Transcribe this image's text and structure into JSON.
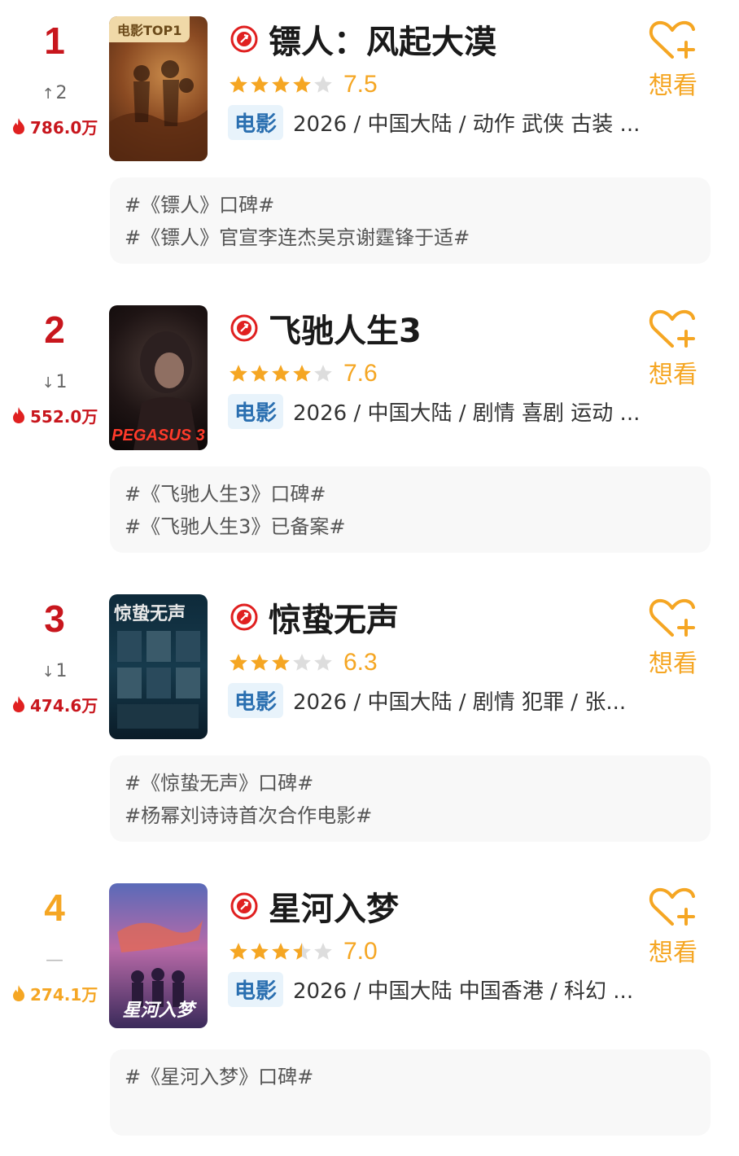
{
  "colors": {
    "rank_red": "#c8161d",
    "rank_orange": "#f5a623",
    "heat_red": "#e02020",
    "heat_orange": "#f5a623",
    "star_gold": "#f5a623",
    "star_grey": "#dddddd",
    "want_gold": "#f5a623",
    "tag_blue": "#2a6fb0"
  },
  "want_label": "想看",
  "type_tag": "电影",
  "items": [
    {
      "rank": "1",
      "change": "2",
      "change_dir": "up",
      "heat": "786.0万",
      "poster_badge": "电影TOP1",
      "title": "镖人：风起大漠",
      "stars": 4,
      "score": "7.5",
      "info": "2026 / 中国大陆 / 动作 武侠 古装 ...",
      "topics": [
        "#《镖人》口碑#",
        "#《镖人》官宣李连杰吴京谢霆锋于适#"
      ]
    },
    {
      "rank": "2",
      "change": "1",
      "change_dir": "down",
      "heat": "552.0万",
      "poster_overlay": "PEGASUS 3",
      "title": "飞驰人生3",
      "stars": 4,
      "score": "7.6",
      "info": "2026 / 中国大陆 / 剧情 喜剧 运动 ...",
      "topics": [
        "#《飞驰人生3》口碑#",
        "#《飞驰人生3》已备案#"
      ]
    },
    {
      "rank": "3",
      "change": "1",
      "change_dir": "down",
      "heat": "474.6万",
      "poster_title": "惊蛰无声",
      "title": "惊蛰无声",
      "stars": 3,
      "score": "6.3",
      "info": "2026 / 中国大陆 / 剧情 犯罪 / 张...",
      "topics": [
        "#《惊蛰无声》口碑#",
        "#杨幂刘诗诗首次合作电影#"
      ]
    },
    {
      "rank": "4",
      "change": "—",
      "change_dir": "none",
      "heat": "274.1万",
      "poster_title": "星河入梦",
      "title": "星河入梦",
      "stars": 3.5,
      "score": "7.0",
      "info": "2026 / 中国大陆 中国香港 / 科幻 ...",
      "topics": [
        "#《星河入梦》口碑#",
        ""
      ]
    }
  ]
}
